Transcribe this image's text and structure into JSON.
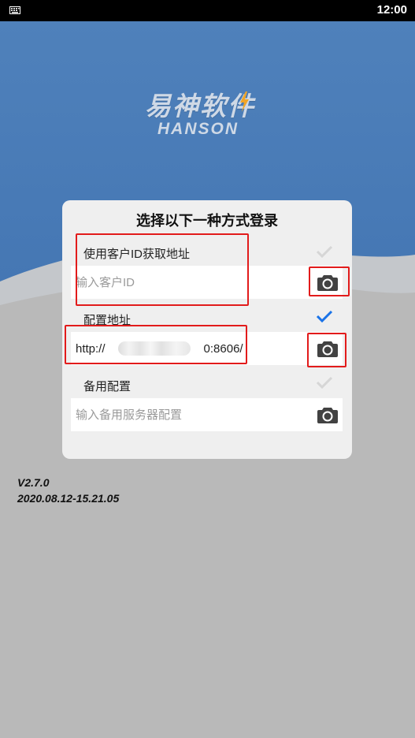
{
  "status_bar": {
    "time": "12:00",
    "left_icon": "keyboard-icon"
  },
  "logo": {
    "chinese": "易神软件",
    "english": "HANSON"
  },
  "dialog": {
    "title": "选择以下一种方式登录",
    "options": [
      {
        "label": "使用客户ID获取地址",
        "placeholder": "输入客户ID",
        "value": "",
        "checked": false
      },
      {
        "label": "配置地址",
        "placeholder": "",
        "value": "http://                              0:8606/",
        "checked": true
      },
      {
        "label": "备用配置",
        "placeholder": "输入备用服务器配置",
        "value": "",
        "checked": false
      }
    ]
  },
  "version": {
    "number": "V2.7.0",
    "build": "2020.08.12-15.21.05"
  },
  "colors": {
    "accent": "#1a73e8",
    "sky": "#4b7fb9",
    "annotation": "#e21b1b"
  },
  "icons": [
    "keyboard-icon",
    "bolt-icon",
    "check-icon",
    "camera-icon"
  ]
}
